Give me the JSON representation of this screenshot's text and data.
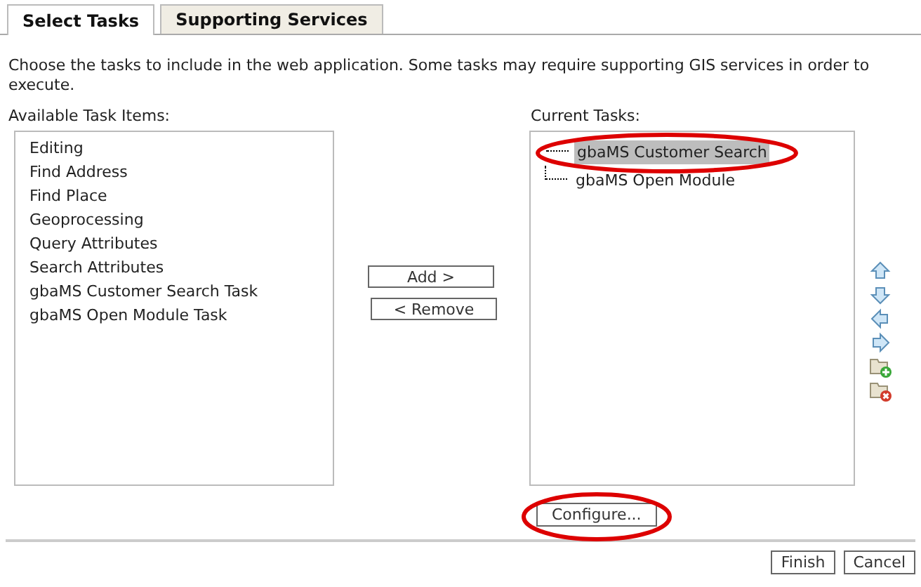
{
  "tabs": [
    {
      "label": "Select Tasks",
      "selected": true
    },
    {
      "label": "Supporting Services",
      "selected": false
    }
  ],
  "description": "Choose the tasks to include in the web application. Some tasks may require supporting GIS services in order to execute.",
  "available": {
    "label": "Available Task Items:",
    "items": [
      "Editing",
      "Find Address",
      "Find Place",
      "Geoprocessing",
      "Query Attributes",
      "Search Attributes",
      "gbaMS Customer Search Task",
      "gbaMS Open Module Task"
    ]
  },
  "middle_buttons": [
    "Add >",
    "< Remove"
  ],
  "current": {
    "label": "Current Tasks:",
    "items": [
      {
        "label": "gbaMS Customer Search",
        "selected": true,
        "highlighted": true
      },
      {
        "label": "gbaMS Open Module",
        "selected": false,
        "highlighted": false
      }
    ]
  },
  "tool_icons": [
    {
      "kind": "up"
    },
    {
      "kind": "down"
    },
    {
      "kind": "left"
    },
    {
      "kind": "right"
    },
    {
      "kind": "add"
    },
    {
      "kind": "remove"
    }
  ],
  "configure": {
    "label": "Configure...",
    "highlighted": true
  },
  "footer_buttons": [
    "Finish",
    "Cancel"
  ]
}
